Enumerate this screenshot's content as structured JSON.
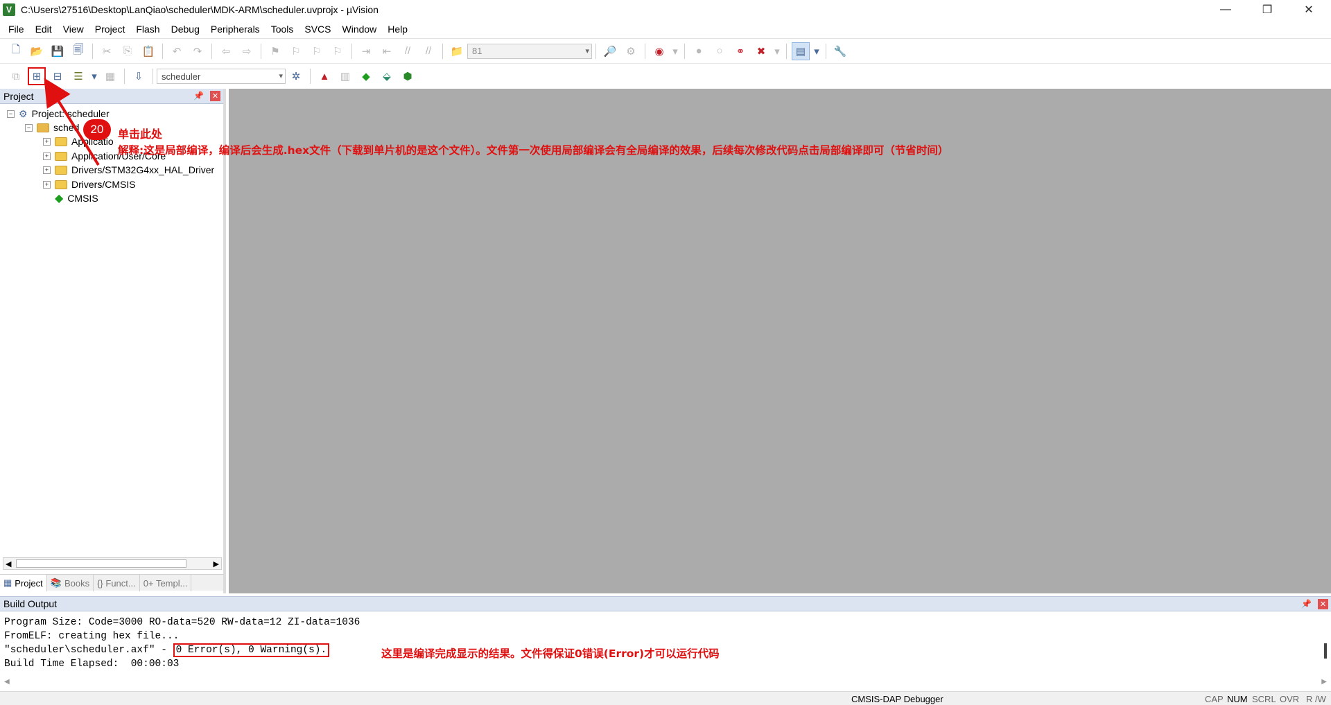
{
  "window": {
    "title": "C:\\Users\\27516\\Desktop\\LanQiao\\scheduler\\MDK-ARM\\scheduler.uvprojx - µVision",
    "app_icon": "V"
  },
  "menu": [
    "File",
    "Edit",
    "View",
    "Project",
    "Flash",
    "Debug",
    "Peripherals",
    "Tools",
    "SVCS",
    "Window",
    "Help"
  ],
  "toolbar1": {
    "find_value": "81"
  },
  "toolbar2": {
    "target_value": "scheduler"
  },
  "project_pane": {
    "title": "Project",
    "root": "Project: scheduler",
    "target": "sched",
    "groups": [
      "Applicatio",
      "Application/User/Core",
      "Drivers/STM32G4xx_HAL_Driver",
      "Drivers/CMSIS"
    ],
    "component": "CMSIS",
    "tabs": [
      "Project",
      "Books",
      "{} Funct...",
      "0+ Templ..."
    ]
  },
  "annotations": {
    "step_number": "20",
    "click_here": "单击此处",
    "explanation": "解释:这是局部编译，编译后会生成.hex文件（下载到单片机的是这个文件）。文件第一次使用局部编译会有全局编译的效果，后续每次修改代码点击局部编译即可（节省时间）",
    "result_note": "这里是编译完成显示的结果。文件得保证0错误(Error)才可以运行代码",
    "highlight_color": "#e01010"
  },
  "build_output": {
    "title": "Build Output",
    "lines": [
      "Program Size: Code=3000 RO-data=520 RW-data=12 ZI-data=1036",
      "FromELF: creating hex file...",
      "\"scheduler\\scheduler.axf\" - ",
      "Build Time Elapsed:  00:00:03"
    ],
    "result": "0 Error(s), 0 Warning(s)."
  },
  "status": {
    "debugger": "CMSIS-DAP Debugger",
    "indicators": [
      "CAP",
      "NUM",
      "SCRL",
      "OVR",
      "R /W"
    ]
  }
}
